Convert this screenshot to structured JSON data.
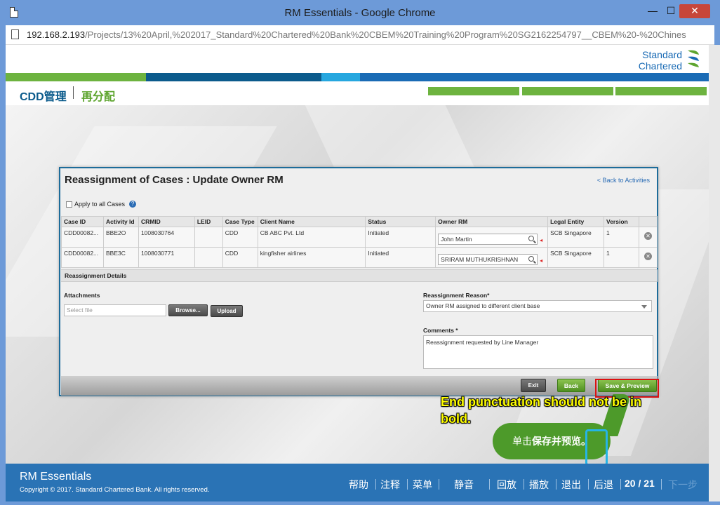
{
  "window": {
    "title": "RM Essentials - Google Chrome",
    "minimize": "—",
    "maximize": "☐",
    "close": "✕"
  },
  "url": {
    "host": "192.168.2.193",
    "path": "/Projects/13%20April,%202017_Standard%20Chartered%20Bank%20CBEM%20Training%20Program%20SG2162254797__CBEM%20-%20Chines"
  },
  "logo": {
    "line1": "Standard",
    "line2": "Chartered"
  },
  "header": {
    "title": "CDD管理",
    "subtitle": "再分配"
  },
  "colors": {
    "brand_blue": "#0b5b8c",
    "brand_green": "#5ea52f",
    "footer_blue": "#2a73b5",
    "panel_border": "#1d6c9a",
    "callout_yellow": "#ffff00",
    "highlight_red": "#d11",
    "bubble_green": "#4d9a2a",
    "cyan_marker": "#25b4e6"
  },
  "panel": {
    "title": "Reassignment of Cases : Update Owner RM",
    "back_link": "< Back to Activities",
    "apply_all": "Apply to all Cases",
    "help_icon": "?",
    "columns": [
      "Case ID",
      "Activity Id",
      "CRMID",
      "LEID",
      "Case Type",
      "Client Name",
      "Status",
      "Owner RM",
      "Legal Entity",
      "Version",
      ""
    ],
    "rows": [
      {
        "case_id": "CDD00082...",
        "activity_id": "BBE2O",
        "crmid": "1008030764",
        "leid": "",
        "case_type": "CDD",
        "client_name": "CB ABC Pvt. Ltd",
        "status": "Initiated",
        "owner_rm": "John Martin",
        "legal_entity": "SCB Singapore",
        "version": "1"
      },
      {
        "case_id": "CDD00082...",
        "activity_id": "BBE3C",
        "crmid": "1008030771",
        "leid": "",
        "case_type": "CDD",
        "client_name": "kingfisher airlines",
        "status": "Initiated",
        "owner_rm": "SRIRAM MUTHUKRISHNAN",
        "legal_entity": "SCB Singapore",
        "version": "1"
      }
    ],
    "owner_marker": "◂",
    "delete_icon": "✕",
    "section_title": "Reassignment Details",
    "attachments_label": "Attachments",
    "file_placeholder": "Select file",
    "browse_label": "Browse...",
    "upload_label": "Upload",
    "reason_label": "Reassignment Reason*",
    "reason_value": "Owner RM assigned to different client base",
    "comments_label": "Comments *",
    "comments_value": "Reassignment requested by Line Manager",
    "exit_label": "Exit",
    "back_label": "Back",
    "save_label": "Save & Preview"
  },
  "annotation": {
    "callout": "End punctuation should not be in bold.",
    "bubble_prefix": "单击",
    "bubble_bold": "保存并预览。"
  },
  "footer": {
    "brand": "RM Essentials",
    "copyright": "Copyright © 2017. Standard Chartered Bank. All rights reserved.",
    "nav": [
      "帮助",
      "注释",
      "菜单",
      "静音",
      "回放",
      "播放",
      "退出",
      "后退"
    ],
    "page": "20 / 21",
    "next": "下一步"
  }
}
